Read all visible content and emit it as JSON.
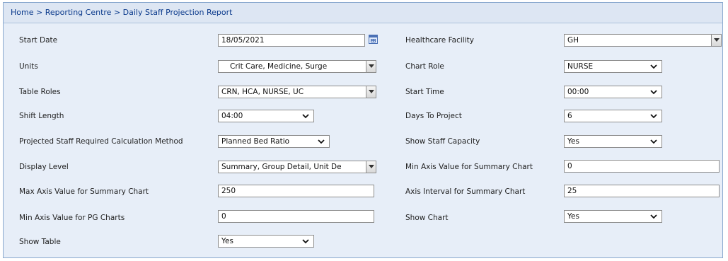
{
  "breadcrumb": "Home > Reporting Centre > Daily Staff Projection Report",
  "fields": {
    "start_date": {
      "label": "Start Date",
      "value": "18/05/2021"
    },
    "units": {
      "label": "Units",
      "value": "Crit Care,    Medicine,    Surge"
    },
    "table_roles": {
      "label": "Table Roles",
      "value": "CRN, HCA, NURSE, UC"
    },
    "shift_length": {
      "label": "Shift Length",
      "value": "04:00"
    },
    "calc_method": {
      "label": "Projected Staff Required Calculation Method",
      "value": "Planned Bed Ratio"
    },
    "display_level": {
      "label": "Display Level",
      "value": "Summary, Group Detail, Unit De"
    },
    "max_axis_summary": {
      "label": "Max Axis Value for Summary Chart",
      "value": "250"
    },
    "min_axis_pg": {
      "label": "Min Axis Value for PG Charts",
      "value": "0"
    },
    "show_table": {
      "label": "Show Table",
      "value": "Yes"
    },
    "healthcare_facility": {
      "label": "Healthcare Facility",
      "value": "GH"
    },
    "chart_role": {
      "label": "Chart Role",
      "value": "NURSE"
    },
    "start_time": {
      "label": "Start Time",
      "value": "00:00"
    },
    "days_to_project": {
      "label": "Days To Project",
      "value": "6"
    },
    "show_staff_capacity": {
      "label": "Show Staff Capacity",
      "value": "Yes"
    },
    "min_axis_summary": {
      "label": "Min Axis Value for Summary Chart",
      "value": "0"
    },
    "axis_interval_summary": {
      "label": "Axis Interval for Summary Chart",
      "value": "25"
    },
    "show_chart": {
      "label": "Show Chart",
      "value": "Yes"
    }
  },
  "icons": {
    "calendar": "calendar-icon",
    "dropdown": "chevron-down-icon"
  },
  "colors": {
    "panel_bg": "#e7eef8",
    "border": "#8aa9cf",
    "breadcrumb_text": "#0b3a8c"
  }
}
